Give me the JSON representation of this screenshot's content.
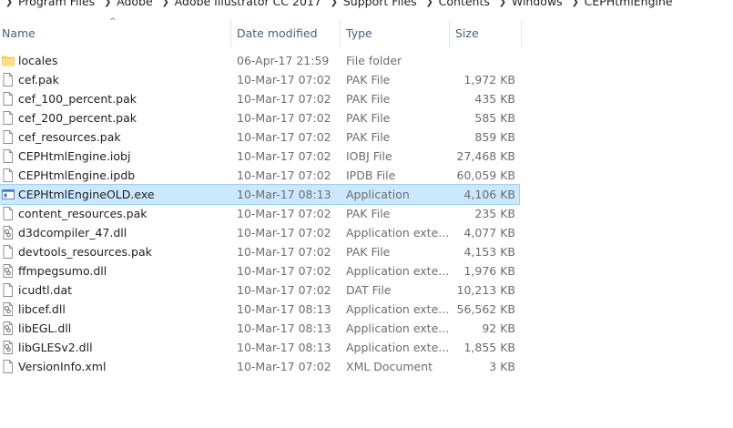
{
  "breadcrumb": [
    "Program Files",
    "Adobe",
    "Adobe Illustrator CC 2017",
    "Support Files",
    "Contents",
    "Windows",
    "CEPHtmlEngine"
  ],
  "columns": {
    "name": "Name",
    "date": "Date modified",
    "type": "Type",
    "size": "Size"
  },
  "sort_arrow": "^",
  "files": [
    {
      "name": "locales",
      "date": "06-Apr-17 21:59",
      "type": "File folder",
      "size": "",
      "icon": "folder-icon"
    },
    {
      "name": "cef.pak",
      "date": "10-Mar-17 07:02",
      "type": "PAK File",
      "size": "1,972 KB",
      "icon": "file-icon"
    },
    {
      "name": "cef_100_percent.pak",
      "date": "10-Mar-17 07:02",
      "type": "PAK File",
      "size": "435 KB",
      "icon": "file-icon"
    },
    {
      "name": "cef_200_percent.pak",
      "date": "10-Mar-17 07:02",
      "type": "PAK File",
      "size": "585 KB",
      "icon": "file-icon"
    },
    {
      "name": "cef_resources.pak",
      "date": "10-Mar-17 07:02",
      "type": "PAK File",
      "size": "859 KB",
      "icon": "file-icon"
    },
    {
      "name": "CEPHtmlEngine.iobj",
      "date": "10-Mar-17 07:02",
      "type": "IOBJ File",
      "size": "27,468 KB",
      "icon": "file-icon"
    },
    {
      "name": "CEPHtmlEngine.ipdb",
      "date": "10-Mar-17 07:02",
      "type": "IPDB File",
      "size": "60,059 KB",
      "icon": "file-icon"
    },
    {
      "name": "CEPHtmlEngineOLD.exe",
      "date": "10-Mar-17 08:13",
      "type": "Application",
      "size": "4,106 KB",
      "icon": "exe-icon",
      "selected": true
    },
    {
      "name": "content_resources.pak",
      "date": "10-Mar-17 07:02",
      "type": "PAK File",
      "size": "235 KB",
      "icon": "file-icon"
    },
    {
      "name": "d3dcompiler_47.dll",
      "date": "10-Mar-17 07:02",
      "type": "Application exte...",
      "size": "4,077 KB",
      "icon": "dll-icon"
    },
    {
      "name": "devtools_resources.pak",
      "date": "10-Mar-17 07:02",
      "type": "PAK File",
      "size": "4,153 KB",
      "icon": "file-icon"
    },
    {
      "name": "ffmpegsumo.dll",
      "date": "10-Mar-17 07:02",
      "type": "Application exte...",
      "size": "1,976 KB",
      "icon": "dll-icon"
    },
    {
      "name": "icudtl.dat",
      "date": "10-Mar-17 07:02",
      "type": "DAT File",
      "size": "10,213 KB",
      "icon": "file-icon"
    },
    {
      "name": "libcef.dll",
      "date": "10-Mar-17 08:13",
      "type": "Application exte...",
      "size": "56,562 KB",
      "icon": "dll-icon"
    },
    {
      "name": "libEGL.dll",
      "date": "10-Mar-17 08:13",
      "type": "Application exte...",
      "size": "92 KB",
      "icon": "dll-icon"
    },
    {
      "name": "libGLESv2.dll",
      "date": "10-Mar-17 08:13",
      "type": "Application exte...",
      "size": "1,855 KB",
      "icon": "dll-icon"
    },
    {
      "name": "VersionInfo.xml",
      "date": "10-Mar-17 07:02",
      "type": "XML Document",
      "size": "3 KB",
      "icon": "file-icon"
    }
  ],
  "colors": {
    "selection": "#cce8ff",
    "selection_border": "#99d1ff",
    "header_text": "#4c607a",
    "folder": "#ffd766"
  }
}
